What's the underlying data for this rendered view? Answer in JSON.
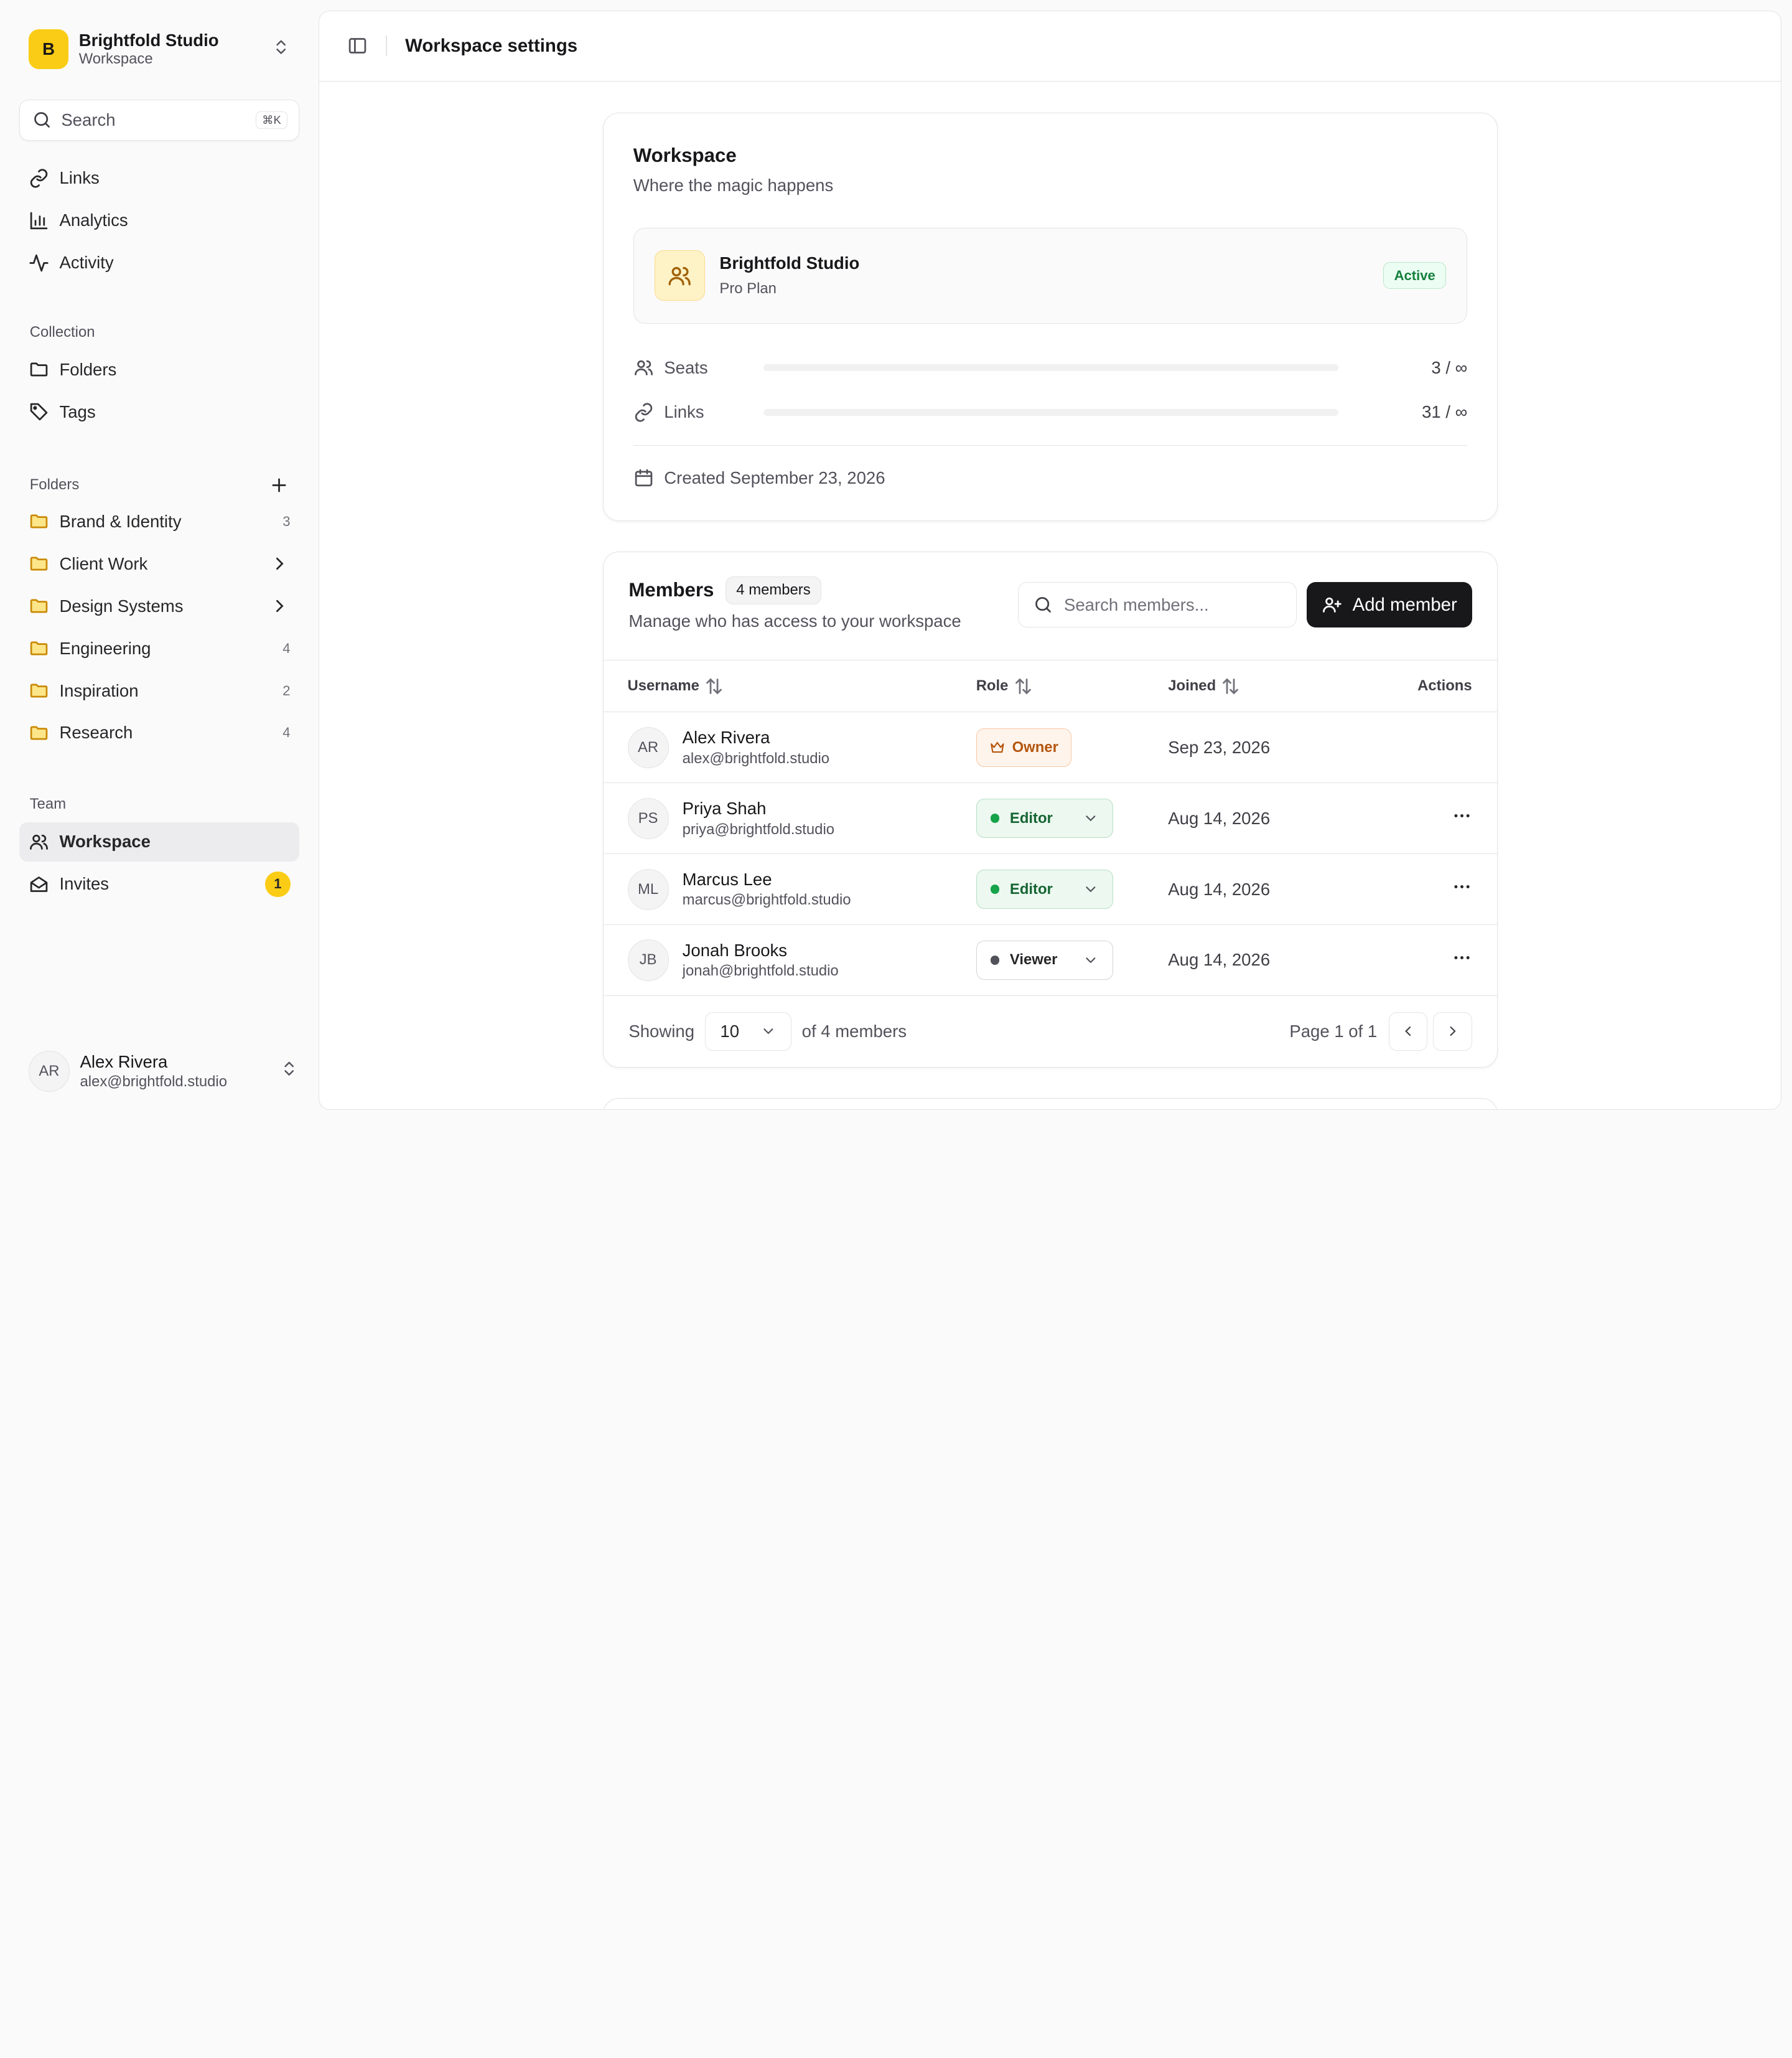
{
  "workspace_switcher": {
    "initial": "B",
    "name": "Brightfold Studio",
    "type": "Workspace"
  },
  "search": {
    "label": "Search",
    "shortcut": "⌘K"
  },
  "nav": [
    {
      "label": "Links",
      "icon": "link-icon"
    },
    {
      "label": "Analytics",
      "icon": "bar-chart-icon"
    },
    {
      "label": "Activity",
      "icon": "activity-icon"
    }
  ],
  "collection": {
    "label": "Collection",
    "items": [
      {
        "label": "Folders",
        "icon": "folder-icon"
      },
      {
        "label": "Tags",
        "icon": "tag-icon"
      }
    ]
  },
  "folders": {
    "label": "Folders",
    "items": [
      {
        "label": "Brand & Identity",
        "count": "3"
      },
      {
        "label": "Client Work",
        "count": ""
      },
      {
        "label": "Design Systems",
        "count": ""
      },
      {
        "label": "Engineering",
        "count": "4"
      },
      {
        "label": "Inspiration",
        "count": "2"
      },
      {
        "label": "Research",
        "count": "4"
      }
    ]
  },
  "team": {
    "label": "Team",
    "workspace_label": "Workspace",
    "invites_label": "Invites",
    "invites_badge": "1"
  },
  "current_user": {
    "initials": "AR",
    "name": "Alex Rivera",
    "email": "alex@brightfold.studio"
  },
  "header": {
    "title": "Workspace settings"
  },
  "workspace_card": {
    "title": "Workspace",
    "subtitle": "Where the magic happens",
    "plan_name": "Brightfold Studio",
    "plan": "Pro Plan",
    "status": "Active",
    "seats_label": "Seats",
    "seats_value": "3 / ∞",
    "seats_fill": 0,
    "links_label": "Links",
    "links_value": "31 / ∞",
    "links_fill": 0,
    "created": "Created September 23, 2026"
  },
  "members": {
    "title": "Members",
    "count_badge": "4 members",
    "subtitle": "Manage who has access to your workspace",
    "search_placeholder": "Search members...",
    "add_label": "Add member",
    "columns": {
      "username": "Username",
      "role": "Role",
      "joined": "Joined",
      "actions": "Actions"
    },
    "rows": [
      {
        "initials": "AR",
        "name": "Alex Rivera",
        "email": "alex@brightfold.studio",
        "role": "Owner",
        "joined": "Sep 23, 2026"
      },
      {
        "initials": "PS",
        "name": "Priya Shah",
        "email": "priya@brightfold.studio",
        "role": "Editor",
        "joined": "Aug 14, 2026"
      },
      {
        "initials": "ML",
        "name": "Marcus Lee",
        "email": "marcus@brightfold.studio",
        "role": "Editor",
        "joined": "Aug 14, 2026"
      },
      {
        "initials": "JB",
        "name": "Jonah Brooks",
        "email": "jonah@brightfold.studio",
        "role": "Viewer",
        "joined": "Aug 14, 2026"
      }
    ],
    "showing_label": "Showing",
    "page_size": "10",
    "of_label": "of 4 members",
    "page_label": "Page 1 of 1"
  },
  "colors": {
    "accent": "#facc15",
    "primary_button": "#18181b",
    "editor": "#16a34a",
    "owner": "#b4560f"
  }
}
